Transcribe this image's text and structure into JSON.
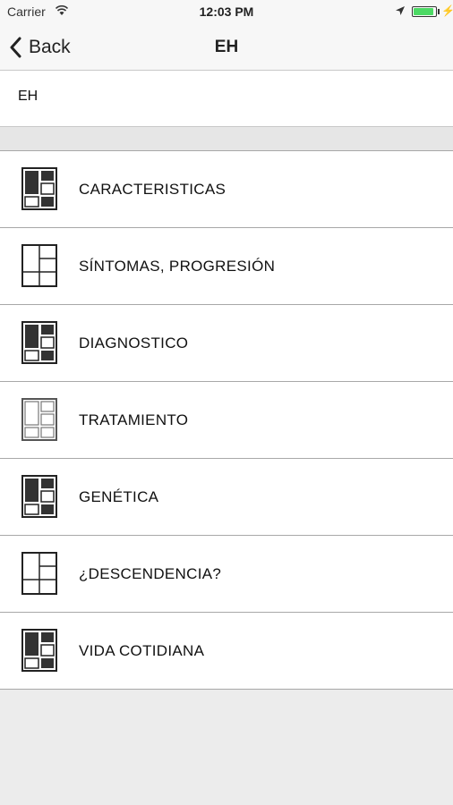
{
  "status": {
    "carrier": "Carrier",
    "time": "12:03 PM",
    "battery_level": 0.9,
    "battery_color": "#4cd964"
  },
  "nav": {
    "back_label": "Back",
    "title": "EH"
  },
  "header": {
    "text": "EH"
  },
  "items": [
    {
      "label": "CARACTERISTICAS",
      "icon": "dark-layout-icon"
    },
    {
      "label": "SÍNTOMAS, PROGRESIÓN",
      "icon": "outline-layout-icon"
    },
    {
      "label": "DIAGNOSTICO",
      "icon": "dark-layout-icon"
    },
    {
      "label": "TRATAMIENTO",
      "icon": "light-outline-layout-icon"
    },
    {
      "label": "GENÉTICA",
      "icon": "dark-layout-icon"
    },
    {
      "label": "¿DESCENDENCIA?",
      "icon": "outline-layout-icon"
    },
    {
      "label": "VIDA COTIDIANA",
      "icon": "dark-layout-icon"
    }
  ]
}
